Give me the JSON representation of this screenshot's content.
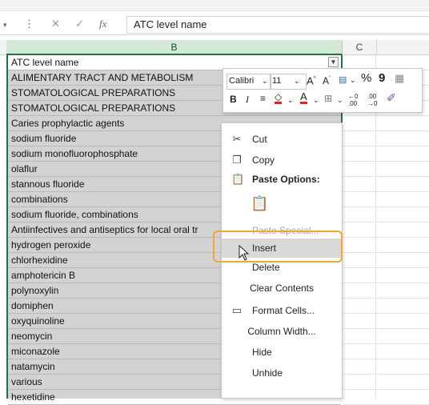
{
  "formula_bar": {
    "fx_label": "fx",
    "value": "ATC level name"
  },
  "columns": {
    "b": "B",
    "c": "C"
  },
  "cells": [
    "ATC level name",
    "ALIMENTARY TRACT AND METABOLISM",
    "STOMATOLOGICAL PREPARATIONS",
    "STOMATOLOGICAL PREPARATIONS",
    "Caries prophylactic agents",
    "sodium fluoride",
    "sodium monofluorophosphate",
    "olaflur",
    "stannous fluoride",
    "combinations",
    "sodium fluoride, combinations",
    "Antiinfectives and antiseptics for local oral tr",
    "hydrogen peroxide",
    "chlorhexidine",
    "amphotericin B",
    "polynoxylin",
    "domiphen",
    "oxyquinoline",
    "neomycin",
    "miconazole",
    "natamycin",
    "various",
    "hexetidine"
  ],
  "mini_toolbar": {
    "font_name": "Calibri",
    "font_size": "11",
    "percent": "%",
    "comma": "9",
    "bold": "B",
    "italic": "I",
    "decimal_increase": ".00",
    "decimal_decrease": ".00"
  },
  "context_menu": {
    "cut": "Cut",
    "copy": "Copy",
    "paste_options": "Paste Options:",
    "paste_special": "Paste Special...",
    "insert": "Insert",
    "delete": "Delete",
    "clear_contents": "Clear Contents",
    "format_cells": "Format Cells...",
    "column_width": "Column Width...",
    "hide": "Hide",
    "unhide": "Unhide"
  },
  "colors": {
    "selection_fill": "#d3d3d3",
    "header_selected": "#d3e9d6",
    "accent_green": "#217346",
    "highlight_orange": "#f0a830"
  }
}
